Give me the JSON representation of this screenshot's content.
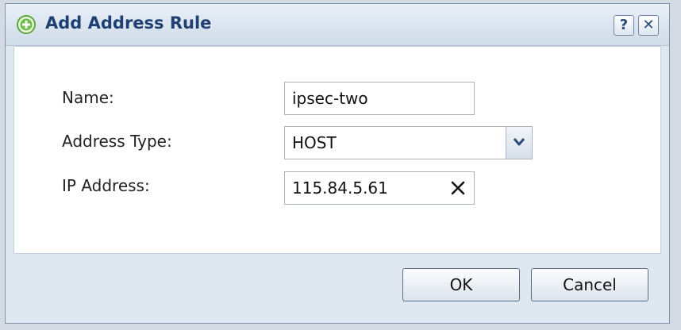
{
  "dialog": {
    "title": "Add Address Rule",
    "help_label": "?",
    "close_label": "✕"
  },
  "form": {
    "name_label": "Name:",
    "name_value": "ipsec-two",
    "address_type_label": "Address Type:",
    "address_type_value": "HOST",
    "ip_label": "IP Address:",
    "ip_value": "115.84.5.61"
  },
  "buttons": {
    "ok": "OK",
    "cancel": "Cancel"
  },
  "icons": {
    "title_icon": "add-icon",
    "dropdown_icon": "chevron-down-icon",
    "clear_icon": "clear-icon"
  },
  "colors": {
    "title": "#1f3f73",
    "add_icon": "#5aa83a"
  }
}
